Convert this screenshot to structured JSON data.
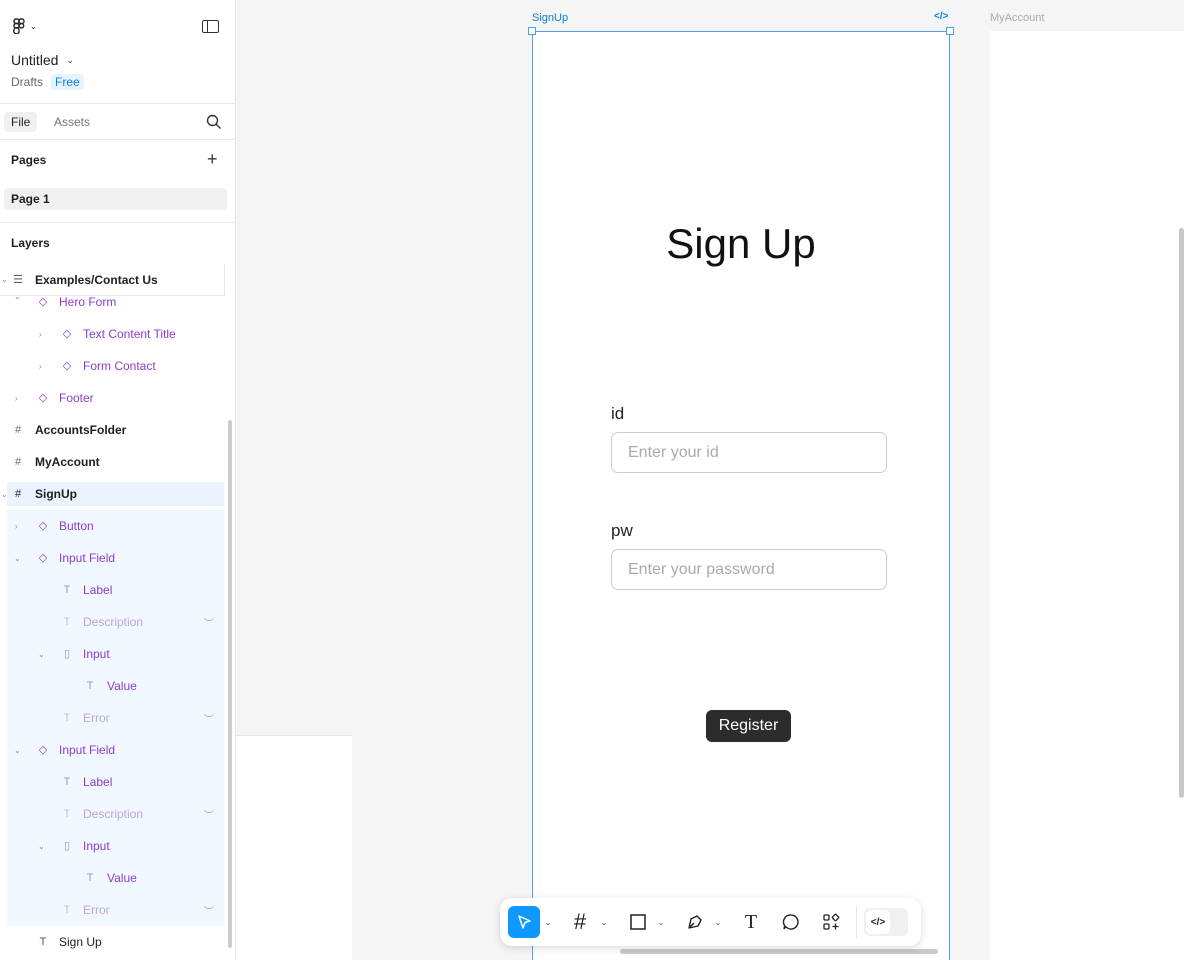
{
  "app": {
    "file_title": "Untitled",
    "drafts": "Drafts",
    "plan": "Free"
  },
  "tabs": {
    "file": "File",
    "assets": "Assets"
  },
  "pages": {
    "heading": "Pages",
    "items": [
      "Page 1"
    ]
  },
  "layers": {
    "heading": "Layers",
    "items": [
      {
        "label": "Examples/Contact Us"
      },
      {
        "label": "Hero Form"
      },
      {
        "label": "Text Content Title"
      },
      {
        "label": "Form Contact"
      },
      {
        "label": "Footer"
      },
      {
        "label": "AccountsFolder"
      },
      {
        "label": "MyAccount"
      },
      {
        "label": "SignUp"
      },
      {
        "label": "Button"
      },
      {
        "label": "Input Field"
      },
      {
        "label": "Label"
      },
      {
        "label": "Description"
      },
      {
        "label": "Input"
      },
      {
        "label": "Value"
      },
      {
        "label": "Error"
      },
      {
        "label": "Input Field"
      },
      {
        "label": "Label"
      },
      {
        "label": "Description"
      },
      {
        "label": "Input"
      },
      {
        "label": "Value"
      },
      {
        "label": "Error"
      },
      {
        "label": "Sign Up"
      }
    ]
  },
  "canvas": {
    "frame_name": "SignUp",
    "other_frame_name": "MyAccount",
    "title": "Sign Up",
    "id_label": "id",
    "id_placeholder": "Enter your id",
    "pw_label": "pw",
    "pw_placeholder": "Enter your password",
    "register": "Register"
  },
  "colors": {
    "accent": "#0d99ff",
    "selection": "#4ba0e8",
    "component": "#8b3dc9"
  }
}
